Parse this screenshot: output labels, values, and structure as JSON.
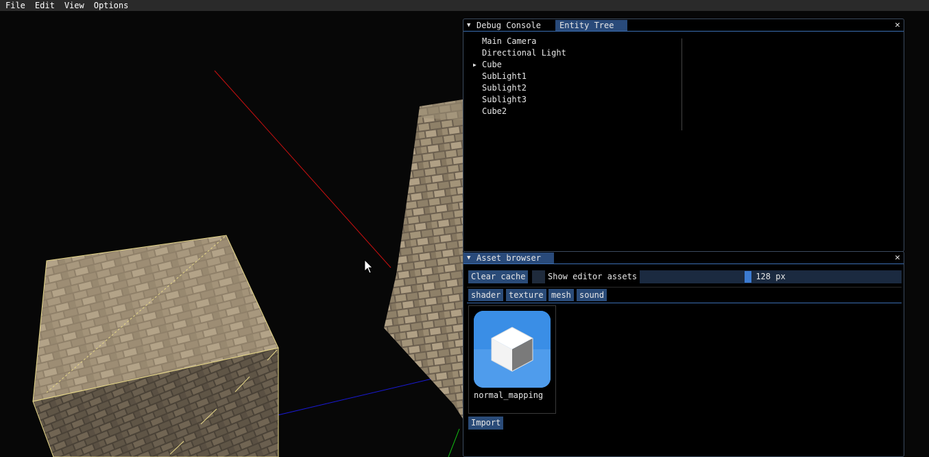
{
  "menu": {
    "items": [
      "File",
      "Edit",
      "View",
      "Options"
    ]
  },
  "entity_panel": {
    "tabs": [
      "Debug Console",
      "Entity Tree"
    ],
    "close_glyph": "✕",
    "entities": [
      "Main Camera",
      "Directional Light",
      "Cube",
      "SubLight1",
      "Sublight2",
      "Sublight3",
      "Cube2"
    ]
  },
  "asset_panel": {
    "title": "Asset browser",
    "close_glyph": "✕",
    "clear_cache": "Clear cache",
    "show_editor_assets": "Show editor assets",
    "thumb_size": "128",
    "thumb_unit": "px",
    "thumb_slider_fraction": 0.41,
    "filters": [
      "shader",
      "texture",
      "mesh",
      "sound"
    ],
    "asset_name": "normal_mapping",
    "import": "Import"
  },
  "colors": {
    "accent": "#294a7a",
    "button": "#2a4b78",
    "slider": "#3c7bd1",
    "asset_icon": "#3a8ee6"
  },
  "icons": [
    "expand-arrow-icon",
    "close-icon",
    "tree-expand-arrow-icon",
    "cube-asset-icon",
    "mouse-cursor-icon"
  ]
}
